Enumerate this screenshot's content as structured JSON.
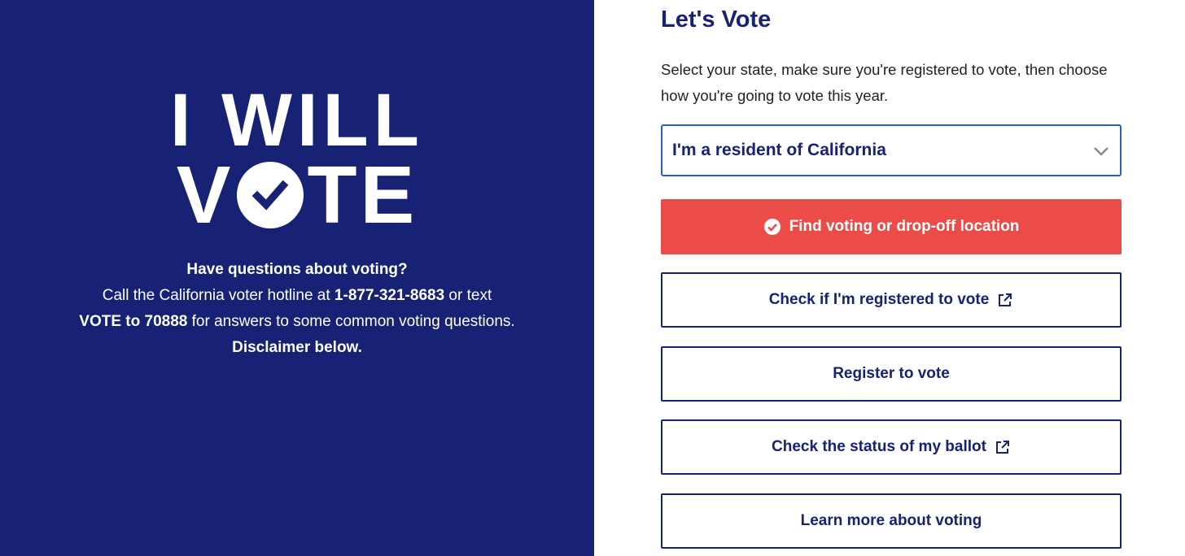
{
  "brand": {
    "navy": "#172275",
    "accent_red": "#ec4c48",
    "focus_blue": "#2a5bd7"
  },
  "logo": {
    "line1": "I WILL",
    "line2_left": "V",
    "line2_right": "TE",
    "check_icon": "check-circle-icon"
  },
  "info": {
    "question": "Have questions about voting?",
    "hotline_prefix": "Call the California voter hotline at ",
    "hotline_number": "1-877-321-8683",
    "text_connector": " or text",
    "text_code": "VOTE to 70888",
    "text_suffix": " for answers to some common voting questions.",
    "disclaimer": "Disclaimer below."
  },
  "panel": {
    "title": "Let's Vote",
    "description": "Select your state, make sure you're registered to vote, then choose how you're going to vote this year."
  },
  "state_select": {
    "value": "I'm a resident of California",
    "icon": "chevron-down-icon"
  },
  "buttons": {
    "find_location": "Find voting or drop-off location",
    "check_registered": "Check if I'm registered to vote",
    "register": "Register to vote",
    "ballot_status": "Check the status of my ballot",
    "learn_more": "Learn more about voting"
  }
}
